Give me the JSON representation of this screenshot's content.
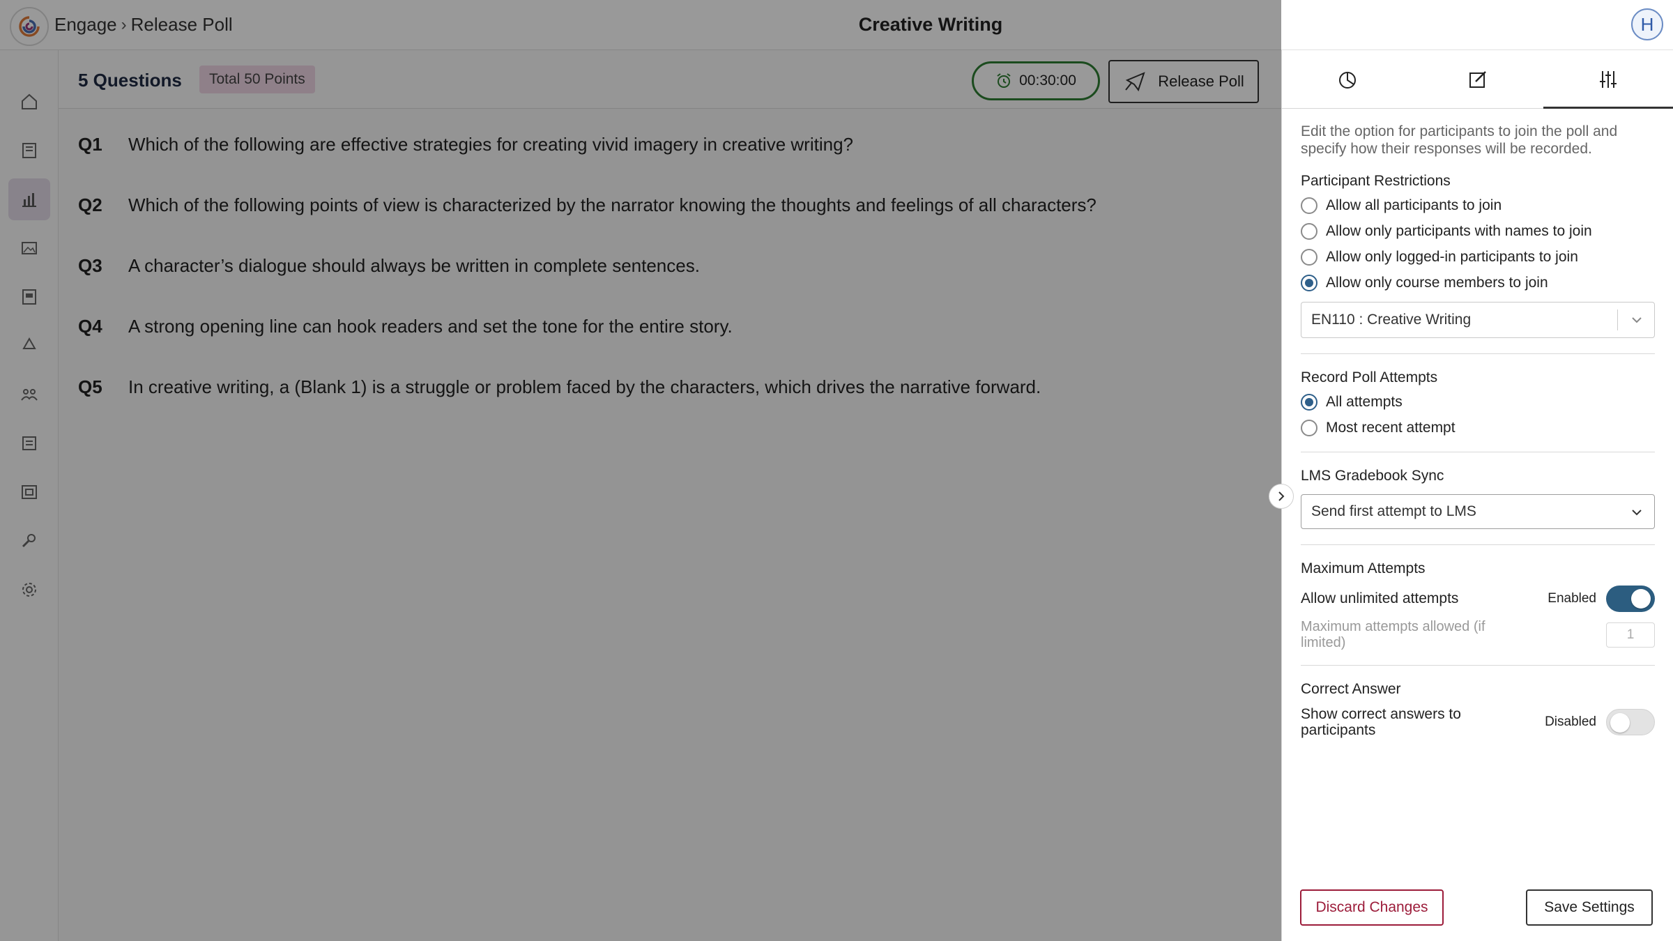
{
  "header": {
    "breadcrumb": [
      "Engage",
      "Release Poll"
    ],
    "title": "Creative Writing",
    "avatar_initial": "H"
  },
  "nav": {
    "items": [
      "home-icon",
      "book-icon",
      "chart-icon",
      "image-icon",
      "report-icon",
      "recycle-icon",
      "people-icon",
      "list-icon",
      "folder-icon",
      "wrench-icon",
      "gear-icon"
    ],
    "active": "chart-icon"
  },
  "poll": {
    "question_count": "5 Questions",
    "points": "Total 50 Points",
    "timer": "00:30:00",
    "release_label": "Release Poll",
    "questions": [
      {
        "num": "Q1",
        "text": "Which of the following are effective strategies for creating vivid imagery in creative writing?"
      },
      {
        "num": "Q2",
        "text": "Which of the following points of view is characterized by the narrator knowing the thoughts and feelings of all characters?"
      },
      {
        "num": "Q3",
        "text": "A character’s dialogue should always be written in complete sentences."
      },
      {
        "num": "Q4",
        "text": "A strong opening line can hook readers and set the tone for the entire story."
      },
      {
        "num": "Q5",
        "text": "In creative writing, a (Blank 1) is a struggle or problem faced by the characters, which drives the narrative forward."
      }
    ]
  },
  "settings": {
    "tabs": [
      "results-tab",
      "edit-tab",
      "settings-tab"
    ],
    "active_tab": "settings-tab",
    "intro": "Edit the option for participants to join the poll and specify how their responses will be recorded.",
    "participant_title": "Participant Restrictions",
    "participant_options": [
      "Allow all participants to join",
      "Allow only participants with names to join",
      "Allow only logged-in participants to join",
      "Allow only course members to join"
    ],
    "participant_selected": 3,
    "course_select": "EN110 : Creative Writing",
    "attempts_title": "Record Poll Attempts",
    "attempts_options": [
      "All attempts",
      "Most recent attempt"
    ],
    "attempts_selected": 0,
    "lms_title": "LMS Gradebook Sync",
    "lms_select": "Send first attempt to LMS",
    "max_title": "Maximum Attempts",
    "unlimited_label": "Allow unlimited attempts",
    "unlimited_state": "Enabled",
    "max_allowed_label": "Maximum attempts allowed (if limited)",
    "max_allowed_value": "1",
    "correct_title": "Correct Answer",
    "show_correct_label": "Show correct answers to participants",
    "show_correct_state": "Disabled",
    "discard_label": "Discard Changes",
    "save_label": "Save Settings"
  }
}
